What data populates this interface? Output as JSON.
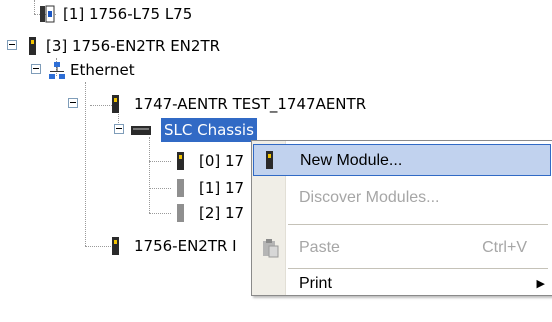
{
  "tree": {
    "items": [
      {
        "label": "[1] 1756-L75 L75"
      },
      {
        "label": "[3] 1756-EN2TR EN2TR"
      },
      {
        "label": "Ethernet"
      },
      {
        "label": "1747-AENTR TEST_1747AENTR"
      },
      {
        "label": "SLC Chassis"
      },
      {
        "label": "[0] 17"
      },
      {
        "label": "[1] 17"
      },
      {
        "label": "[2] 17"
      },
      {
        "label": "1756-EN2TR I"
      }
    ]
  },
  "context_menu": {
    "items": [
      {
        "label": "New Module...",
        "shortcut": "",
        "enabled": true
      },
      {
        "label": "Discover Modules...",
        "shortcut": "",
        "enabled": false
      },
      {
        "label": "Paste",
        "shortcut": "Ctrl+V",
        "enabled": false
      },
      {
        "label": "Print",
        "shortcut": "",
        "enabled": true,
        "submenu_arrow": "▶"
      }
    ]
  },
  "colors": {
    "selection": "#316ac5",
    "menu_highlight": "#c1d2ee"
  }
}
